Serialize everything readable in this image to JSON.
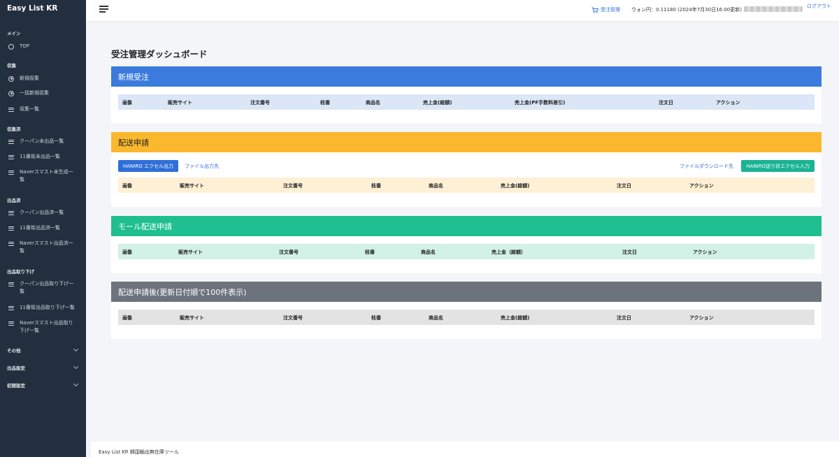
{
  "sidebar": {
    "brand": "Easy List KR",
    "sections": {
      "main": "メイン",
      "collect": "収集",
      "collected": "収集済",
      "listed": "出品済",
      "withdraw": "出品取り下げ"
    },
    "items": {
      "top": "TOP",
      "new_collect": "新規収集",
      "bulk_collect": "一括新規収集",
      "collect_list": "収集一覧",
      "coupang_unlisted": "クーパン未出品一覧",
      "st11_unlisted": "11番街未出品一覧",
      "naver_ungenerated": "Naverスマスト未生成一覧",
      "coupang_listed": "クーパン出品済一覧",
      "st11_listed": "11番街出品済一覧",
      "naver_listed": "Naverスマスト出品済一覧",
      "coupang_withdraw": "クーパン出品取り下げ一覧",
      "st11_withdraw": "11番街出品取り下げ一覧",
      "naver_withdraw": "Naverスマスト出品取り下げ一覧"
    },
    "collapsibles": {
      "other": "その他",
      "listing_settings": "出品設定",
      "initial_settings": "初期設定"
    }
  },
  "topbar": {
    "order_mgmt": "受注管理",
    "rate": "ウォン円：0.11180 (2024年7月30日16:00更新)",
    "logout": "ログアウト"
  },
  "page_title": "受注管理ダッシュボード",
  "cards": {
    "new_orders": {
      "title": "新規受注",
      "color": "#3a7bdd",
      "header_bg": "#dbe6f6",
      "columns": [
        "画像",
        "販売サイト",
        "注文番号",
        "枝番",
        "商品名",
        "売上金(総額)",
        "売上金(PF手数料差引)",
        "注文日",
        "アクション"
      ]
    },
    "shipping": {
      "title": "配送申請",
      "color": "#fbb82e",
      "header_bg": "#fef0d5",
      "btn_excel_out": "HANIRO エクセル出力",
      "link_output_dest": "ファイル出力先",
      "link_download_dest": "ファイルダウンロード先",
      "btn_excel_in": "HANIRO送り状エクセル入力",
      "columns": [
        "画像",
        "販売サイト",
        "注文番号",
        "枝番",
        "商品名",
        "売上金(総額)",
        "注文日",
        "アクション"
      ]
    },
    "mall_shipping": {
      "title": "モール配送申請",
      "color": "#1fbf8f",
      "header_bg": "#d2f1e7",
      "columns": [
        "画像",
        "販売サイト",
        "注文番号",
        "枝番",
        "商品名",
        "売上金（総額）",
        "注文日",
        "アクション"
      ]
    },
    "after_shipping": {
      "title": "配送申請後(更新日付順で100件表示)",
      "color": "#6c737c",
      "header_bg": "#e3e3e3",
      "columns": [
        "画像",
        "販売サイト",
        "注文番号",
        "枝番",
        "商品名",
        "売上金(総額)",
        "注文日",
        "アクション"
      ]
    }
  },
  "footer": "Easy List KR 韓国輸出無在庫ツール"
}
